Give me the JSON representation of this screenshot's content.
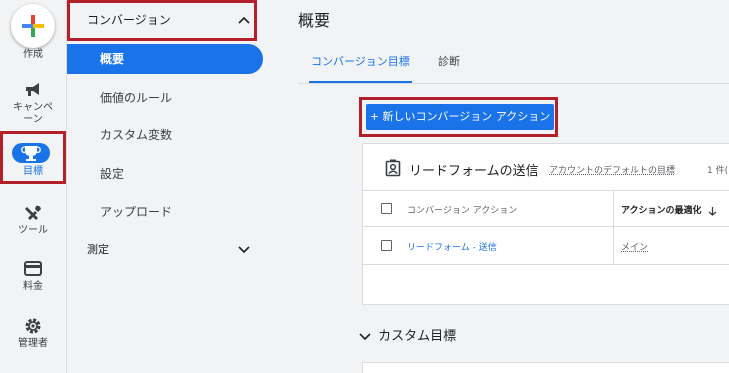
{
  "rail": {
    "create_label": "作成",
    "items": [
      {
        "label": "キャンペーン",
        "icon": "megaphone-icon"
      },
      {
        "label": "目標",
        "icon": "trophy-icon"
      },
      {
        "label": "ツール",
        "icon": "tools-icon"
      },
      {
        "label": "料金",
        "icon": "credit-card-icon"
      },
      {
        "label": "管理者",
        "icon": "gear-icon"
      }
    ]
  },
  "subnav": {
    "header": "コンバージョン",
    "items": [
      {
        "label": "概要",
        "active": true
      },
      {
        "label": "価値のルール"
      },
      {
        "label": "カスタム変数"
      },
      {
        "label": "設定"
      },
      {
        "label": "アップロード"
      }
    ],
    "measure": "測定"
  },
  "main": {
    "title": "概要",
    "tabs": [
      {
        "label": "コンバージョン目標",
        "active": true
      },
      {
        "label": "診断"
      }
    ],
    "new_button": "+ 新しいコンバージョン アクション",
    "card": {
      "title": "リードフォームの送信",
      "subtitle": "アカウントのデフォルトの目標",
      "count": "1 件(",
      "col1": "コンバージョン アクション",
      "col2": "アクションの最適化",
      "row_action": "リードフォーム - 送信",
      "row_opt": "メイン"
    },
    "section": "カスタム目標"
  },
  "colors": {
    "accent": "#1a73e8",
    "highlight": "#b3202a"
  }
}
